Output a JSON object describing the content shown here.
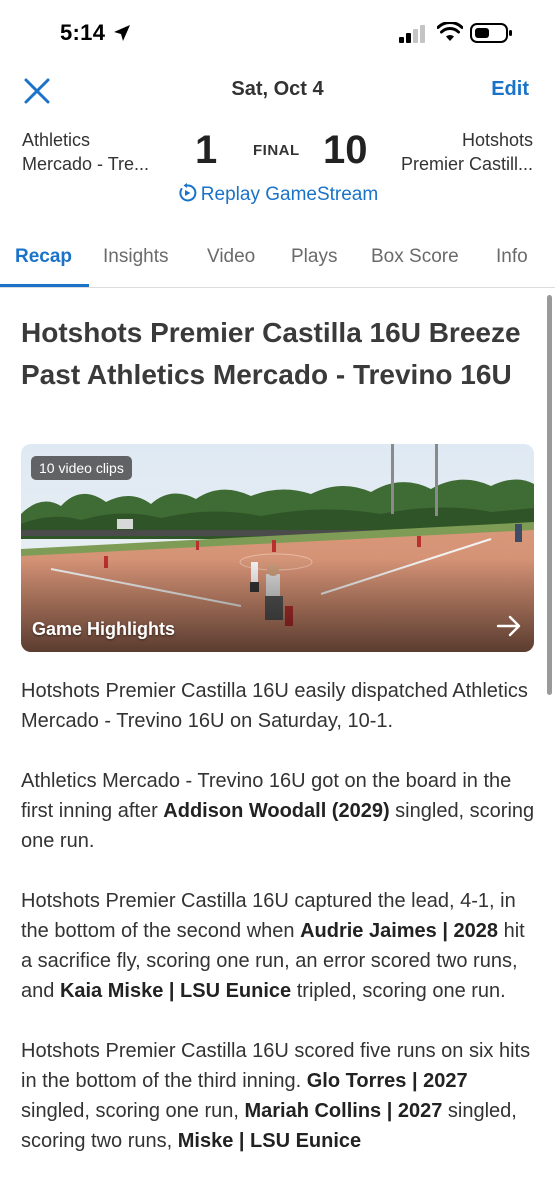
{
  "status_bar": {
    "time": "5:14"
  },
  "nav": {
    "date": "Sat, Oct 4",
    "edit_label": "Edit"
  },
  "score": {
    "away_line1": "Athletics",
    "away_line2": "Mercado - Tre...",
    "away_score": "1",
    "status": "FINAL",
    "home_score": "10",
    "home_line1": "Hotshots",
    "home_line2": "Premier Castill..."
  },
  "replay_label": "Replay GameStream",
  "tabs": [
    {
      "label": "Recap",
      "active": true
    },
    {
      "label": "Insights"
    },
    {
      "label": "Video"
    },
    {
      "label": "Plays"
    },
    {
      "label": "Box Score"
    },
    {
      "label": "Info"
    }
  ],
  "headline": "Hotshots Premier Castilla 16U Breeze Past Athletics Mercado - Trevino 16U",
  "video": {
    "badge": "10 video clips",
    "title": "Game Highlights"
  },
  "story": {
    "p1": "Hotshots Premier Castilla 16U easily dispatched Athletics Mercado - Trevino 16U on Saturday, 10-1.",
    "p2": {
      "a": "Athletics Mercado - Trevino 16U got on the board in the first inning after ",
      "b": "Addison Woodall (2029)",
      "c": " singled, scoring one run."
    },
    "p3": {
      "a": "Hotshots Premier Castilla 16U captured the lead, 4-1, in the bottom of the second when ",
      "b": "Audrie Jaimes | 2028",
      "c": " hit a sacrifice fly, scoring one run, an error scored two runs, and ",
      "d": "Kaia Miske | LSU Eunice",
      "e": " tripled, scoring one run."
    },
    "p4": {
      "a": "Hotshots Premier Castilla 16U scored five runs on six hits in the bottom of the third inning. ",
      "b": "Glo Torres | 2027",
      "c": " singled, scoring one run, ",
      "d": "Mariah Collins | 2027",
      "e": " singled, scoring two runs, ",
      "f": "Miske | LSU Eunice"
    }
  },
  "colors": {
    "accent": "#1a73c8",
    "text": "#333333"
  }
}
